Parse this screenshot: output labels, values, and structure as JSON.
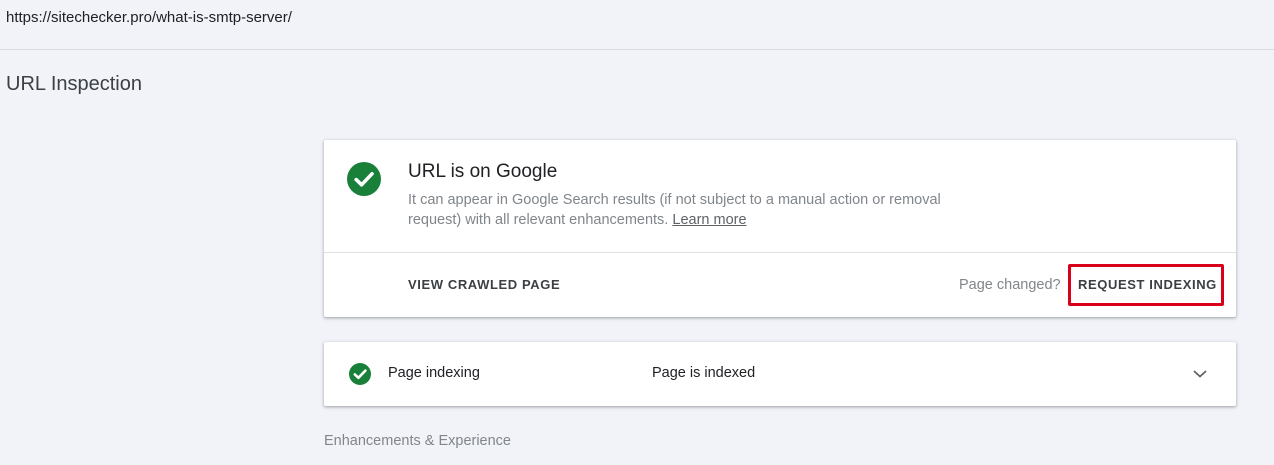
{
  "url_bar": {
    "url": "https://sitechecker.pro/what-is-smtp-server/"
  },
  "page": {
    "title": "URL Inspection"
  },
  "status_card": {
    "heading": "URL is on Google",
    "description": "It can appear in Google Search results (if not subject to a manual action or removal request) with all relevant enhancements.",
    "learn_more": "Learn more",
    "view_crawled_page": "VIEW CRAWLED PAGE",
    "page_changed": "Page changed?",
    "request_indexing": "REQUEST INDEXING",
    "status_icon": "check-circle-icon",
    "status_color": "#188038",
    "highlight_color": "#d9001a"
  },
  "indexing_row": {
    "label": "Page indexing",
    "value": "Page is indexed",
    "status_icon": "check-circle-icon",
    "expand_icon": "chevron-down-icon"
  },
  "enhancements": {
    "title": "Enhancements & Experience"
  }
}
